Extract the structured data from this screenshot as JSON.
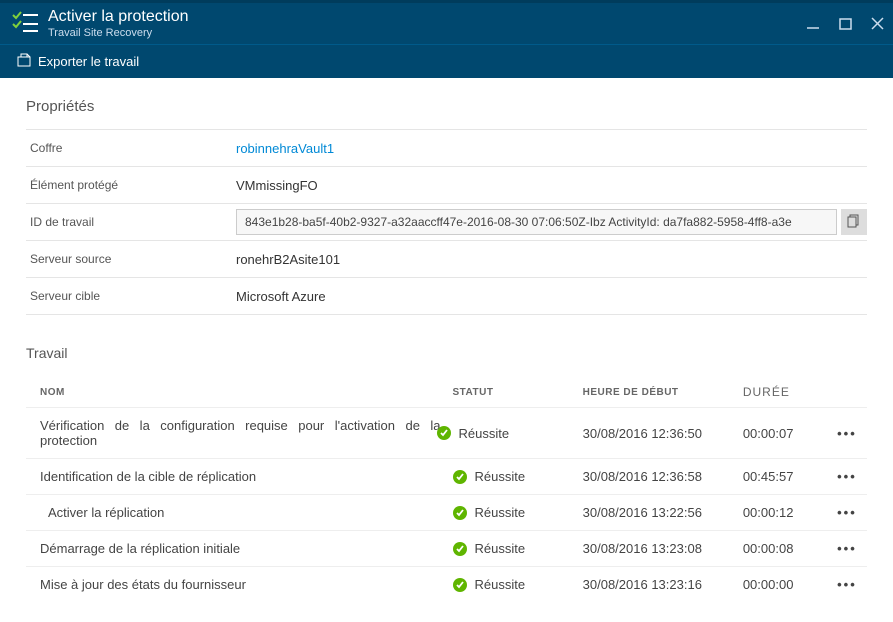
{
  "titlebar": {
    "title": "Activer la protection",
    "subtitle": "Travail Site Recovery"
  },
  "toolbar": {
    "export_label": "Exporter le travail"
  },
  "section_props_title": "Propriétés",
  "props": {
    "vault_label": "Coffre",
    "vault_value": "robinnehraVault1",
    "protected_label": "Élément protégé",
    "protected_value": "VMmissingFO",
    "jobid_label": "ID de travail",
    "jobid_value": "843e1b28-ba5f-40b2-9327-a32aaccff47e-2016-08-30 07:06:50Z-Ibz ActivityId: da7fa882-5958-4ff8-a3e",
    "source_label": "Serveur source",
    "source_value": "ronehrB2Asite101",
    "target_label": "Serveur cible",
    "target_value": "Microsoft Azure"
  },
  "jobs_title": "Travail",
  "columns": {
    "name": "NOM",
    "status": "STATUT",
    "start": "HEURE DE DÉBUT",
    "duration": "DURÉE"
  },
  "status_success": "Réussite",
  "rows": [
    {
      "name": "Vérification de la configuration requise pour l'activation de la protection",
      "start": "30/08/2016 12:36:50",
      "dur": "00:00:07",
      "indent": false,
      "overlap": true
    },
    {
      "name": "Identification de la cible de réplication",
      "start": "30/08/2016 12:36:58",
      "dur": "00:45:57",
      "indent": false,
      "overlap": false
    },
    {
      "name": "Activer la réplication",
      "start": "30/08/2016 13:22:56",
      "dur": "00:00:12",
      "indent": true,
      "overlap": false
    },
    {
      "name": "Démarrage de la réplication initiale",
      "start": "30/08/2016 13:23:08",
      "dur": "00:00:08",
      "indent": false,
      "overlap": false
    },
    {
      "name": "Mise à jour des états du fournisseur",
      "start": "30/08/2016 13:23:16",
      "dur": "00:00:00",
      "indent": false,
      "overlap": false
    }
  ]
}
